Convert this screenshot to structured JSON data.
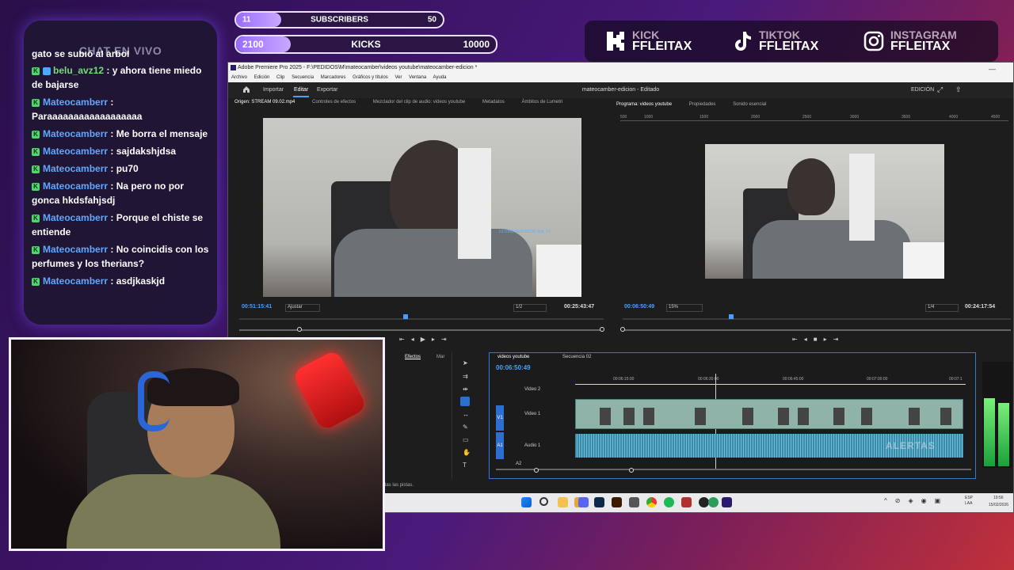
{
  "goals": {
    "subscribers": {
      "current": "11",
      "label": "SUBSCRIBERS",
      "target": "50",
      "progress": 0.22
    },
    "kicks": {
      "current": "2100",
      "label": "KICKS",
      "target": "10000",
      "progress": 0.21
    }
  },
  "chat": {
    "title": "CHAT EN VIVO",
    "messages": [
      {
        "user": "",
        "text": "gato se subió al árbol"
      },
      {
        "user": "belu_avz12",
        "text": ": y ahora tiene miedo de bajarse"
      },
      {
        "user": "Mateocamberr",
        "text": ": Paraaaaaaaaaaaaaaaaaa"
      },
      {
        "user": "Mateocamberr",
        "text": ": Me borra el mensaje"
      },
      {
        "user": "Mateocamberr",
        "text": ": sajdakshjdsa"
      },
      {
        "user": "Mateocamberr",
        "text": ": pu70"
      },
      {
        "user": "Mateocamberr",
        "text": ": Na pero no por gonca hkdsfahjsdj"
      },
      {
        "user": "Mateocamberr",
        "text": ": Porque el chiste se entiende"
      },
      {
        "user": "Mateocamberr",
        "text": ": No coincidis con los perfumes y los therians?"
      },
      {
        "user": "Mateocamberr",
        "text": ": asdjkaskjd"
      }
    ]
  },
  "socials": [
    {
      "platform": "KICK",
      "handle": "FFLEITAX",
      "icon": "kick-logo-icon"
    },
    {
      "platform": "TIKTOK",
      "handle": "FFLEITAX",
      "icon": "tiktok-logo-icon"
    },
    {
      "platform": "INSTAGRAM",
      "handle": "FFLEITAX",
      "icon": "instagram-logo-icon"
    }
  ],
  "premiere": {
    "window_title": "Adobe Premiere Pro 2025 - F:\\PEDIDOS\\M\\mateocamber\\videos youtube\\mateocamber-edicion *",
    "menu": [
      "Archivo",
      "Edición",
      "Clip",
      "Secuencia",
      "Marcadores",
      "Gráficos y títulos",
      "Ver",
      "Ventana",
      "Ayuda"
    ],
    "top_tabs": [
      "Importar",
      "Editar",
      "Exportar"
    ],
    "project_name": "mateocamber-edicion - Editado",
    "workspace": "EDICIÓN",
    "source": {
      "tabs": [
        "Origen: STREAM 09.02.mp4",
        "Controles de efectos",
        "Mezclador del clip de audio: videos youtube",
        "Metadatos",
        "Ámbitos de Lumetri"
      ],
      "timecode_in": "00:51:15:41",
      "fit": "Ajustar",
      "resolution": "1/2",
      "timecode_out": "00:25:43:47",
      "overlay_follower": "ULTIMO SEGUIDOR  mgt_19"
    },
    "program": {
      "tabs": [
        "Programa: videos youtube",
        "Propiedades",
        "Sonido esencial"
      ],
      "ruler": [
        "500",
        "1000",
        "1500",
        "2000",
        "2500",
        "3000",
        "3500",
        "4000",
        "4500"
      ],
      "timecode_in": "00:06:50:49",
      "zoom": "15%",
      "resolution": "1/4",
      "timecode_out": "00:24:17:54"
    },
    "timeline": {
      "tabs": [
        "videos youtube",
        "Secuencia 02"
      ],
      "timecode": "00:06:50:49",
      "ruler": [
        "00:06:15:00",
        "00:06:30:00",
        "00:06:45:00",
        "00:07:00:00",
        "00:07:1"
      ],
      "tracks": [
        "Video 2",
        "Video 1",
        "Audio 1"
      ],
      "v1_label": "V1",
      "a1_label": "A1",
      "a2_label": "A2",
      "alerts_overlay": "ALERTAS"
    },
    "effects_tabs": [
      "Efectos",
      "Mar"
    ],
    "status_text": "das las pistas.",
    "taskbar": {
      "lang": "ESP\nLAA",
      "time": "19:56",
      "date": "15/02/2026"
    }
  }
}
